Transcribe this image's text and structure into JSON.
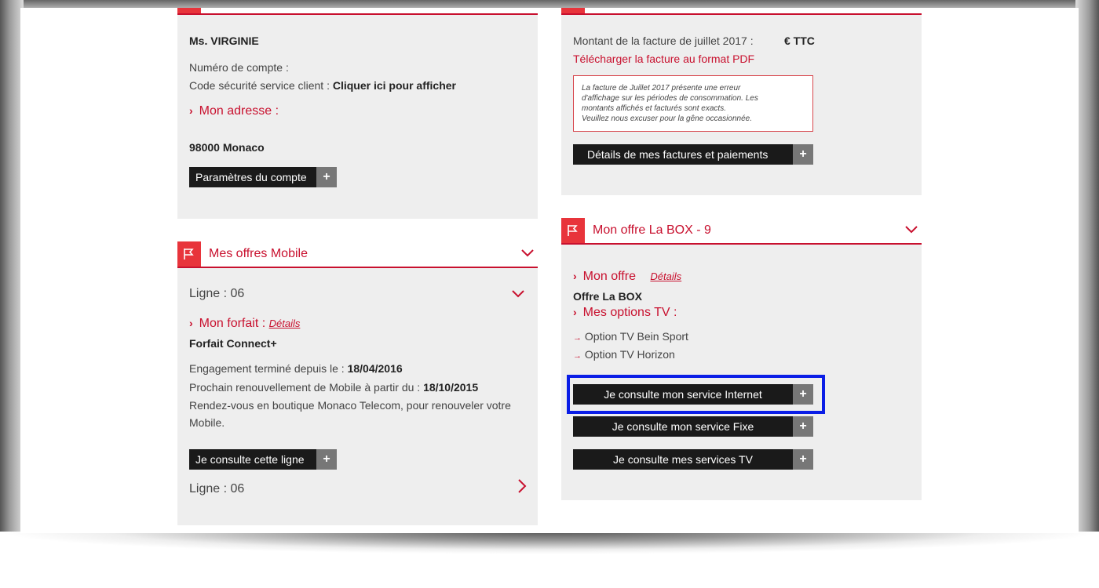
{
  "account": {
    "name": "Ms. VIRGINIE",
    "account_number_label": "Numéro de compte :",
    "security_code_label": "Code sécurité service client :",
    "security_code_link": "Cliquer ici pour afficher",
    "address_title": "Mon adresse :",
    "address_value": "98000 Monaco",
    "settings_button": "Paramètres du compte"
  },
  "invoice": {
    "amount_label": "Montant de la facture de juillet 2017 :",
    "amount_value": "€ TTC",
    "download_link": "Télécharger la facture au format PDF",
    "notice_lines": [
      "La facture de Juillet 2017 présente une erreur",
      "d'affichage sur les périodes de consommation. Les",
      "montants affichés et facturés sont exacts.",
      "Veuillez nous excuser pour la gêne occasionnée."
    ],
    "details_button": "Détails de mes factures et paiements"
  },
  "mobile": {
    "section_title": "Mes offres Mobile",
    "line1_label": "Ligne : 06",
    "forfait_title": "Mon forfait",
    "forfait_sep": ":",
    "forfait_details": "Détails",
    "forfait_value": "Forfait Connect+",
    "engagement_label": "Engagement terminé depuis le :",
    "engagement_date": "18/04/2016",
    "renewal_label": "Prochain renouvellement de Mobile à partir du :",
    "renewal_date": "18/10/2015",
    "renewal_text_1": "Rendez-vous en boutique Monaco Telecom, pour renouveler votre",
    "renewal_text_2": "Mobile.",
    "consult_button": "Je consulte cette ligne",
    "line2_label": "Ligne : 06"
  },
  "box": {
    "section_title": "Mon offre La BOX - 9",
    "offer_title": "Mon offre",
    "offer_details": "Détails",
    "offer_value": "Offre La BOX",
    "tv_options_title": "Mes options TV :",
    "tv_options": [
      "Option TV Bein Sport",
      "Option TV Horizon"
    ],
    "internet_button": "Je consulte mon service Internet",
    "fixe_button": "Je consulte mon service Fixe",
    "tv_button": "Je consulte mes services TV"
  },
  "icons": {
    "plus": "+",
    "option_arrow": "→"
  },
  "colors": {
    "accent": "#c8102e",
    "highlight": "#0a1de6",
    "button_bg": "#1a1a1a"
  }
}
